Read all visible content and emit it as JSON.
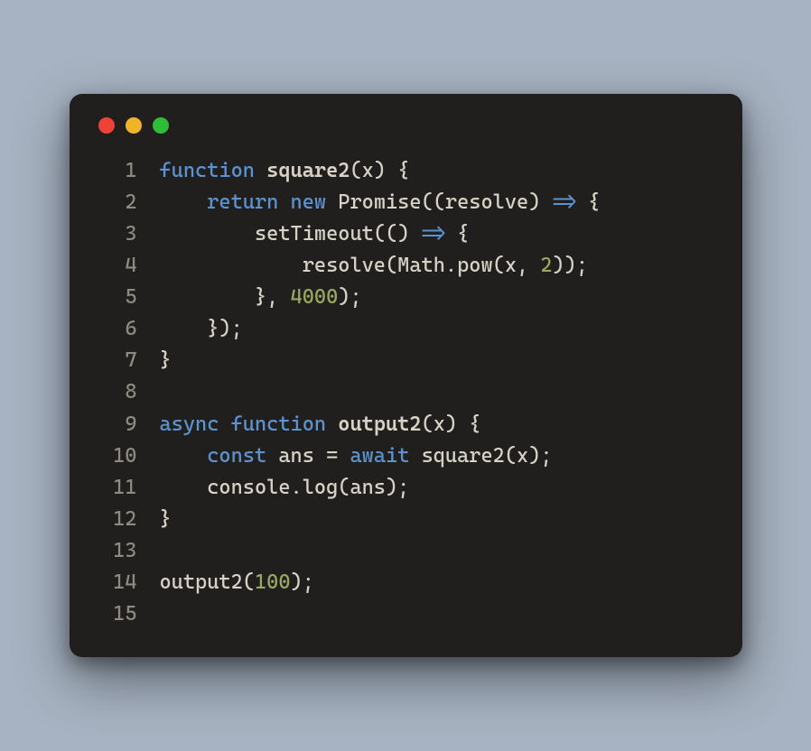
{
  "window": {
    "traffic_lights": [
      "red",
      "yellow",
      "green"
    ]
  },
  "code": {
    "language": "javascript",
    "line_numbers": [
      "1",
      "2",
      "3",
      "4",
      "5",
      "6",
      "7",
      "8",
      "9",
      "10",
      "11",
      "12",
      "13",
      "14",
      "15"
    ],
    "lines": [
      [
        {
          "t": "function ",
          "c": "k"
        },
        {
          "t": "square2",
          "c": "fn"
        },
        {
          "t": "(x) {",
          "c": "id"
        }
      ],
      [
        {
          "t": "    ",
          "c": "id"
        },
        {
          "t": "return ",
          "c": "k"
        },
        {
          "t": "new ",
          "c": "k"
        },
        {
          "t": "Promise((resolve) ",
          "c": "id"
        },
        {
          "t": "=>",
          "c": "ar"
        },
        {
          "t": " {",
          "c": "id"
        }
      ],
      [
        {
          "t": "        setTimeout(() ",
          "c": "id"
        },
        {
          "t": "=>",
          "c": "ar"
        },
        {
          "t": " {",
          "c": "id"
        }
      ],
      [
        {
          "t": "            resolve(Math.pow(x, ",
          "c": "id"
        },
        {
          "t": "2",
          "c": "nu"
        },
        {
          "t": "));",
          "c": "id"
        }
      ],
      [
        {
          "t": "        }, ",
          "c": "id"
        },
        {
          "t": "4000",
          "c": "nu"
        },
        {
          "t": ");",
          "c": "id"
        }
      ],
      [
        {
          "t": "    });",
          "c": "id"
        }
      ],
      [
        {
          "t": "}",
          "c": "id"
        }
      ],
      [
        {
          "t": "",
          "c": "id"
        }
      ],
      [
        {
          "t": "async ",
          "c": "k"
        },
        {
          "t": "function ",
          "c": "k"
        },
        {
          "t": "output2",
          "c": "fn"
        },
        {
          "t": "(x) {",
          "c": "id"
        }
      ],
      [
        {
          "t": "    ",
          "c": "id"
        },
        {
          "t": "const ",
          "c": "k"
        },
        {
          "t": "ans = ",
          "c": "id"
        },
        {
          "t": "await ",
          "c": "k"
        },
        {
          "t": "square2(x);",
          "c": "id"
        }
      ],
      [
        {
          "t": "    console.log(ans);",
          "c": "id"
        }
      ],
      [
        {
          "t": "}",
          "c": "id"
        }
      ],
      [
        {
          "t": "",
          "c": "id"
        }
      ],
      [
        {
          "t": "output2(",
          "c": "id"
        },
        {
          "t": "100",
          "c": "nu"
        },
        {
          "t": ");",
          "c": "id"
        }
      ],
      [
        {
          "t": "",
          "c": "id"
        }
      ]
    ]
  }
}
